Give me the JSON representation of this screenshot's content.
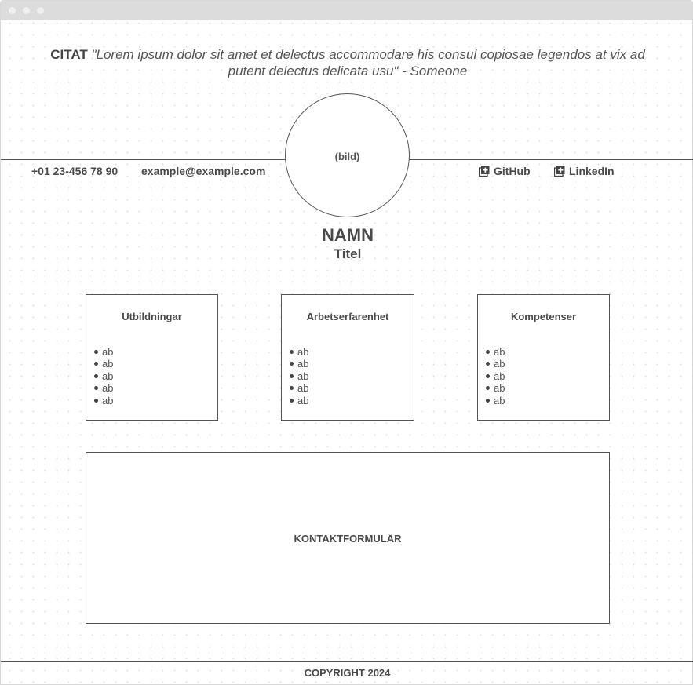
{
  "quote": {
    "label": "CITAT",
    "text": "\"Lorem ipsum dolor sit amet et delectus accommodare his consul copiosae legendos at vix ad putent delectus delicata usu\" - Someone"
  },
  "profile": {
    "image_placeholder": "(bild)",
    "name": "NAMN",
    "title": "Titel"
  },
  "contact": {
    "phone": "+01 23-456 78 90",
    "email": "example@example.com"
  },
  "social": {
    "github": "GitHub",
    "linkedin": "LinkedIn",
    "icon": "external-link-square-icon"
  },
  "sections": [
    {
      "heading": "Utbildningar",
      "items": [
        "ab",
        "ab",
        "ab",
        "ab",
        "ab"
      ]
    },
    {
      "heading": "Arbetserfarenhet",
      "items": [
        "ab",
        "ab",
        "ab",
        "ab",
        "ab"
      ]
    },
    {
      "heading": "Kompetenser",
      "items": [
        "ab",
        "ab",
        "ab",
        "ab",
        "ab"
      ]
    }
  ],
  "contact_form": {
    "label": "KONTAKTFORMULÄR"
  },
  "footer": {
    "copyright": "COPYRIGHT 2024"
  },
  "colors": {
    "border": "#555555",
    "text": "#4a4a4a",
    "titlebar": "#dcdcdc"
  }
}
